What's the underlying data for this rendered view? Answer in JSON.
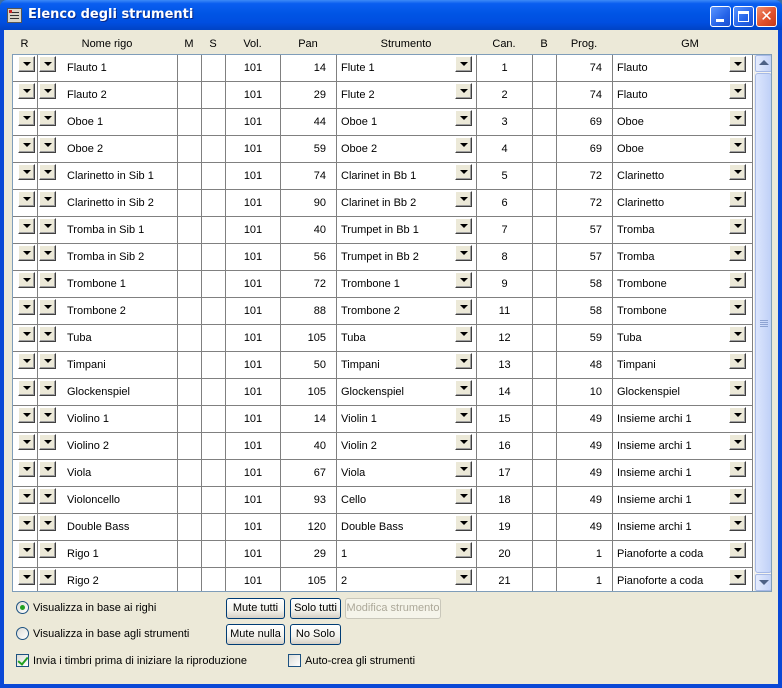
{
  "window": {
    "title": "Elenco degli strumenti"
  },
  "columns": {
    "r": "R",
    "nome_rigo": "Nome rigo",
    "m": "M",
    "s": "S",
    "vol": "Vol.",
    "pan": "Pan",
    "strumento": "Strumento",
    "can": "Can.",
    "b": "B",
    "prog": "Prog.",
    "gm": "GM"
  },
  "rows": [
    {
      "nome": "Flauto 1",
      "vol": "101",
      "pan": "14",
      "strumento": "Flute 1",
      "can": "1",
      "prog": "74",
      "gm": "Flauto"
    },
    {
      "nome": "Flauto 2",
      "vol": "101",
      "pan": "29",
      "strumento": "Flute 2",
      "can": "2",
      "prog": "74",
      "gm": "Flauto"
    },
    {
      "nome": "Oboe 1",
      "vol": "101",
      "pan": "44",
      "strumento": "Oboe 1",
      "can": "3",
      "prog": "69",
      "gm": "Oboe"
    },
    {
      "nome": "Oboe 2",
      "vol": "101",
      "pan": "59",
      "strumento": "Oboe 2",
      "can": "4",
      "prog": "69",
      "gm": "Oboe"
    },
    {
      "nome": "Clarinetto in Sib 1",
      "vol": "101",
      "pan": "74",
      "strumento": "Clarinet in Bb 1",
      "can": "5",
      "prog": "72",
      "gm": "Clarinetto"
    },
    {
      "nome": "Clarinetto in Sib 2",
      "vol": "101",
      "pan": "90",
      "strumento": "Clarinet in Bb 2",
      "can": "6",
      "prog": "72",
      "gm": "Clarinetto"
    },
    {
      "nome": "Tromba in Sib 1",
      "vol": "101",
      "pan": "40",
      "strumento": "Trumpet in Bb 1",
      "can": "7",
      "prog": "57",
      "gm": "Tromba"
    },
    {
      "nome": "Tromba in Sib 2",
      "vol": "101",
      "pan": "56",
      "strumento": "Trumpet in Bb 2",
      "can": "8",
      "prog": "57",
      "gm": "Tromba"
    },
    {
      "nome": "Trombone 1",
      "vol": "101",
      "pan": "72",
      "strumento": "Trombone 1",
      "can": "9",
      "prog": "58",
      "gm": "Trombone"
    },
    {
      "nome": "Trombone 2",
      "vol": "101",
      "pan": "88",
      "strumento": "Trombone 2",
      "can": "11",
      "prog": "58",
      "gm": "Trombone"
    },
    {
      "nome": "Tuba",
      "vol": "101",
      "pan": "105",
      "strumento": "Tuba",
      "can": "12",
      "prog": "59",
      "gm": "Tuba"
    },
    {
      "nome": "Timpani",
      "vol": "101",
      "pan": "50",
      "strumento": "Timpani",
      "can": "13",
      "prog": "48",
      "gm": "Timpani"
    },
    {
      "nome": "Glockenspiel",
      "vol": "101",
      "pan": "105",
      "strumento": "Glockenspiel",
      "can": "14",
      "prog": "10",
      "gm": "Glockenspiel"
    },
    {
      "nome": "Violino 1",
      "vol": "101",
      "pan": "14",
      "strumento": "Violin 1",
      "can": "15",
      "prog": "49",
      "gm": "Insieme archi 1"
    },
    {
      "nome": "Violino 2",
      "vol": "101",
      "pan": "40",
      "strumento": "Violin 2",
      "can": "16",
      "prog": "49",
      "gm": "Insieme archi 1"
    },
    {
      "nome": "Viola",
      "vol": "101",
      "pan": "67",
      "strumento": "Viola",
      "can": "17",
      "prog": "49",
      "gm": "Insieme archi 1"
    },
    {
      "nome": "Violoncello",
      "vol": "101",
      "pan": "93",
      "strumento": "Cello",
      "can": "18",
      "prog": "49",
      "gm": "Insieme archi 1"
    },
    {
      "nome": "Double Bass",
      "vol": "101",
      "pan": "120",
      "strumento": "Double Bass",
      "can": "19",
      "prog": "49",
      "gm": "Insieme archi 1"
    },
    {
      "nome": "Rigo 1",
      "vol": "101",
      "pan": "29",
      "strumento": "1",
      "can": "20",
      "prog": "1",
      "gm": "Pianoforte a coda"
    },
    {
      "nome": "Rigo 2",
      "vol": "101",
      "pan": "105",
      "strumento": "2",
      "can": "21",
      "prog": "1",
      "gm": "Pianoforte a coda"
    }
  ],
  "options": {
    "view_by_staves": "Visualizza in base ai righi",
    "view_by_instruments": "Visualizza in base agli strumenti",
    "view_mode_selected": "view_by_staves",
    "send_patches": "Invia i timbri prima di iniziare la riproduzione",
    "send_patches_checked": true,
    "auto_create": "Auto-crea gli strumenti",
    "auto_create_checked": false
  },
  "buttons": {
    "mute_all": "Mute tutti",
    "solo_all": "Solo tutti",
    "edit_instrument": "Modifica strumento",
    "mute_none": "Mute nulla",
    "no_solo": "No Solo"
  },
  "colors": {
    "titlebar": "#0055e5",
    "dialog_bg": "#ece9d8",
    "check_green": "#21a121"
  },
  "icons": {
    "app": "instrument-list-icon",
    "dropdown": "chevron-down-icon"
  }
}
